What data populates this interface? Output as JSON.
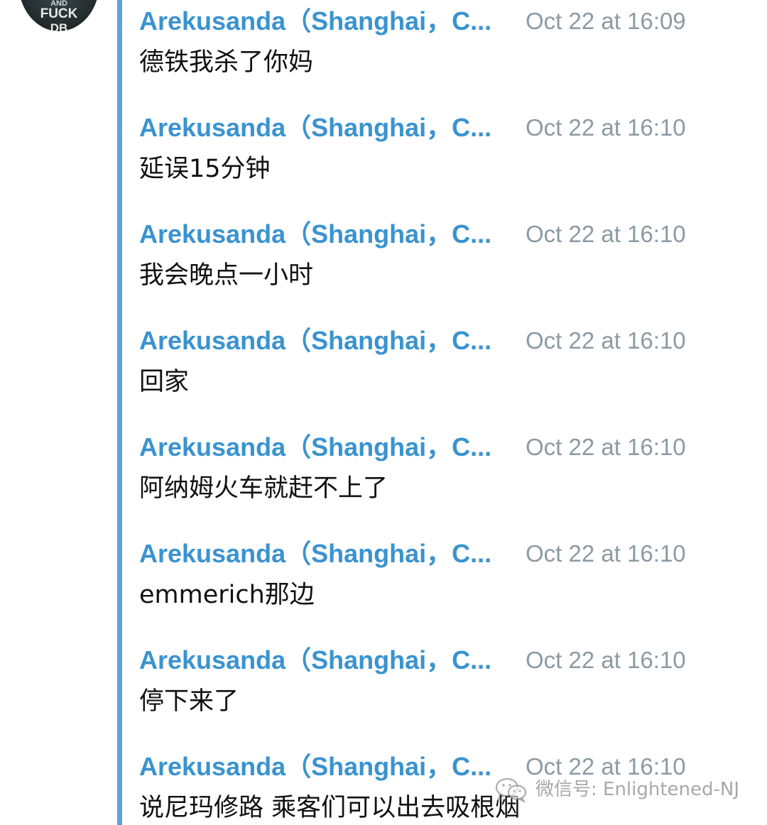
{
  "avatar": {
    "line1": "AND",
    "line2": "FUCK",
    "line3": "DB"
  },
  "messages": [
    {
      "sender": "Arekusanda（Shanghai，C...",
      "time": "Oct 22 at 16:09",
      "text": "德铁我杀了你妈"
    },
    {
      "sender": "Arekusanda（Shanghai，C...",
      "time": "Oct 22 at 16:10",
      "text": "延误15分钟"
    },
    {
      "sender": "Arekusanda（Shanghai，C...",
      "time": "Oct 22 at 16:10",
      "text": "我会晚点一小时"
    },
    {
      "sender": "Arekusanda（Shanghai，C...",
      "time": "Oct 22 at 16:10",
      "text": "回家"
    },
    {
      "sender": "Arekusanda（Shanghai，C...",
      "time": "Oct 22 at 16:10",
      "text": "阿纳姆火车就赶不上了"
    },
    {
      "sender": "Arekusanda（Shanghai，C...",
      "time": "Oct 22 at 16:10",
      "text": "emmerich那边"
    },
    {
      "sender": "Arekusanda（Shanghai，C...",
      "time": "Oct 22 at 16:10",
      "text": "停下来了"
    },
    {
      "sender": "Arekusanda（Shanghai，C...",
      "time": "Oct 22 at 16:10",
      "text": "说尼玛修路 乘客们可以出去吸根烟"
    }
  ],
  "watermark": {
    "icon": "wechat-icon",
    "text": "微信号: Enlightened-NJ"
  },
  "colors": {
    "sender": "#3a93cf",
    "quote_bar": "#5fa4d4",
    "timestamp": "#8b9aa3"
  }
}
